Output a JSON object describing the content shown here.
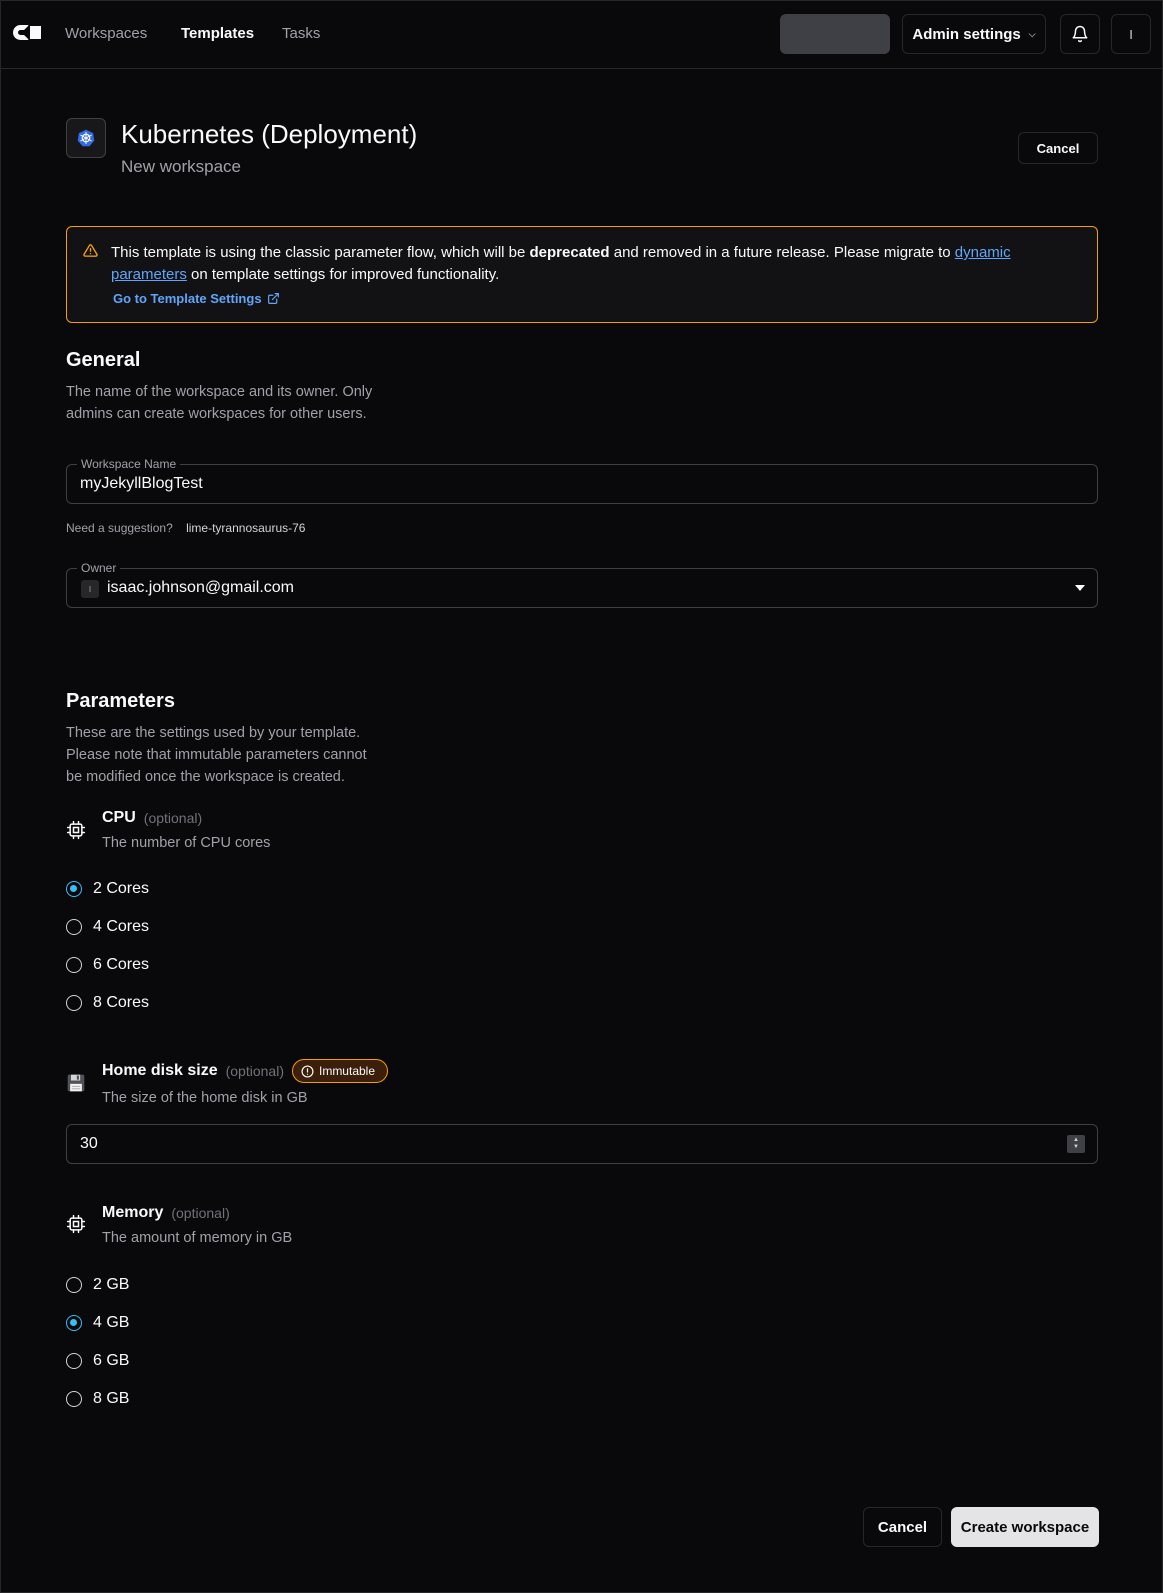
{
  "nav": {
    "logo": "coder-logo",
    "links": [
      "Workspaces",
      "Templates",
      "Tasks"
    ],
    "active": "Templates",
    "admin_settings": "Admin settings",
    "avatar_initial": "I"
  },
  "header": {
    "title": "Kubernetes (Deployment)",
    "subtitle": "New workspace",
    "cancel": "Cancel"
  },
  "alert": {
    "text_before": "This template is using the classic parameter flow, which will be ",
    "text_bold": "deprecated",
    "text_middle": " and removed in a future release. Please migrate to ",
    "link": "dynamic parameters",
    "text_after": " on template settings for improved functionality.",
    "settings_link": "Go to Template Settings"
  },
  "general": {
    "title": "General",
    "description": "The name of the workspace and its owner. Only admins can create workspaces for other users.",
    "workspace_name_label": "Workspace Name",
    "workspace_name": "myJekyllBlogTest",
    "suggestion_label": "Need a suggestion?",
    "suggestion": "lime-tyrannosaurus-76",
    "owner_label": "Owner",
    "owner_avatar": "I",
    "owner": "isaac.johnson@gmail.com"
  },
  "parameters": {
    "title": "Parameters",
    "description": "These are the settings used by your template. Please note that immutable parameters cannot be modified once the workspace is created.",
    "cpu": {
      "name": "CPU",
      "optional": "(optional)",
      "description": "The number of CPU cores",
      "icon": "cpu-icon",
      "options": [
        "2 Cores",
        "4 Cores",
        "6 Cores",
        "8 Cores"
      ],
      "selected": "2 Cores"
    },
    "home_disk": {
      "name": "Home disk size",
      "optional": "(optional)",
      "badge": "Immutable",
      "description": "The size of the home disk in GB",
      "icon": "floppy-disk-icon",
      "value": "30"
    },
    "memory": {
      "name": "Memory",
      "optional": "(optional)",
      "description": "The amount of memory in GB",
      "icon": "cpu-icon",
      "options": [
        "2 GB",
        "4 GB",
        "6 GB",
        "8 GB"
      ],
      "selected": "4 GB"
    }
  },
  "footer": {
    "cancel": "Cancel",
    "create": "Create workspace"
  },
  "colors": {
    "background": "#09090b",
    "warning_border": "#f59e0b",
    "link": "#60a5fa",
    "radio_accent": "#38bdf8"
  }
}
